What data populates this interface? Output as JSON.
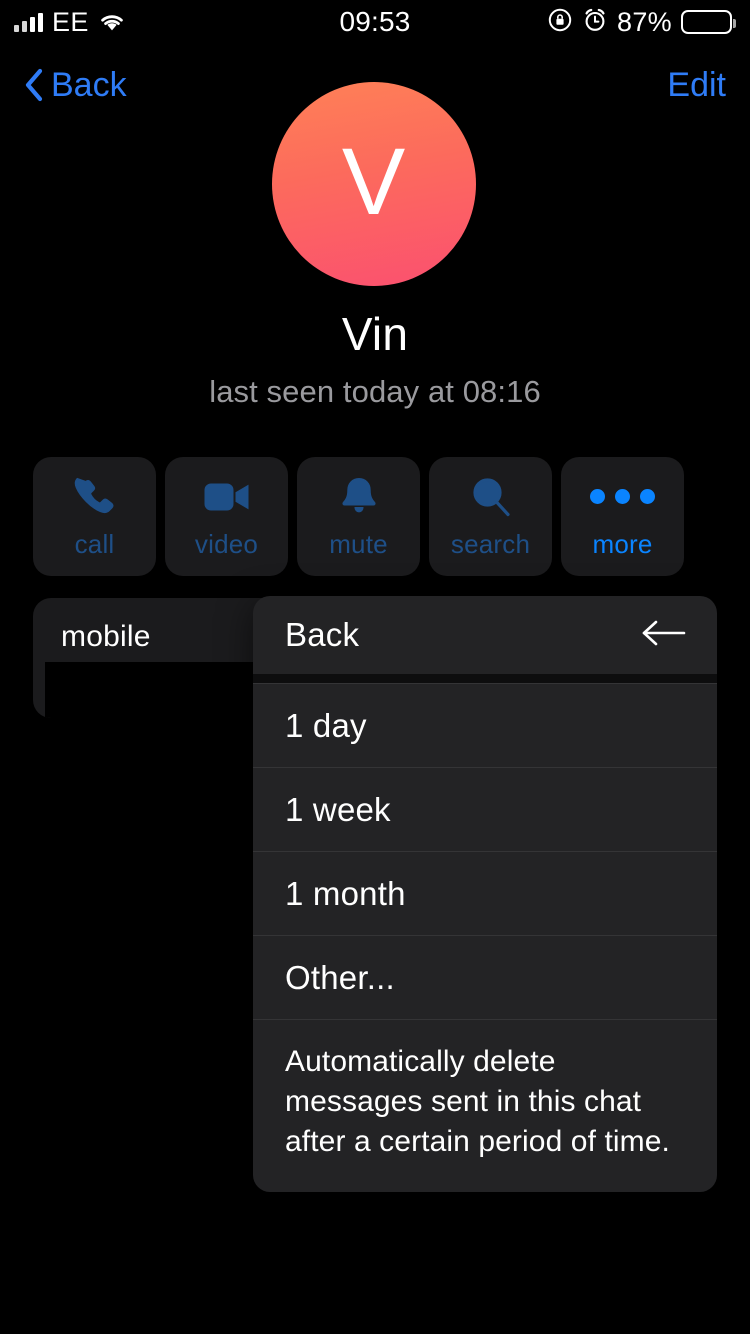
{
  "status_bar": {
    "carrier": "EE",
    "time": "09:53",
    "battery_percent": "87%",
    "battery_level": 87,
    "signal_bars_filled": 2,
    "icons": [
      "signal-bars-icon",
      "wifi-icon",
      "rotation-lock-icon",
      "alarm-icon",
      "battery-icon"
    ]
  },
  "nav_bar": {
    "back_label": "Back",
    "edit_label": "Edit",
    "accent_color": "#2f7cf6"
  },
  "profile": {
    "avatar_initial": "V",
    "avatar_gradient_from": "#ff8157",
    "avatar_gradient_to": "#fb5070",
    "name": "Vin",
    "status": "last seen today at 08:16"
  },
  "actions": [
    {
      "label": "call",
      "icon": "phone-icon",
      "state": "dim"
    },
    {
      "label": "video",
      "icon": "video-icon",
      "state": "dim"
    },
    {
      "label": "mute",
      "icon": "bell-icon",
      "state": "dim"
    },
    {
      "label": "search",
      "icon": "search-icon",
      "state": "dim"
    },
    {
      "label": "more",
      "icon": "ellipsis-icon",
      "state": "bright"
    }
  ],
  "info_card": {
    "label": "mobile",
    "value": "",
    "value_redacted": true
  },
  "context_menu": {
    "header_label": "Back",
    "header_icon": "arrow-left-icon",
    "items": [
      {
        "label": "1 day"
      },
      {
        "label": "1 week"
      },
      {
        "label": "1 month"
      },
      {
        "label": "Other..."
      }
    ],
    "footer": "Automatically delete messages sent in this chat after a certain period of time."
  },
  "theme": {
    "background": "#000000",
    "card": "#1b1b1d",
    "menu": "#232325",
    "accent_blue": "#0a84ff",
    "dim_blue": "#1e4f87",
    "secondary_text": "#9a9a9e"
  }
}
